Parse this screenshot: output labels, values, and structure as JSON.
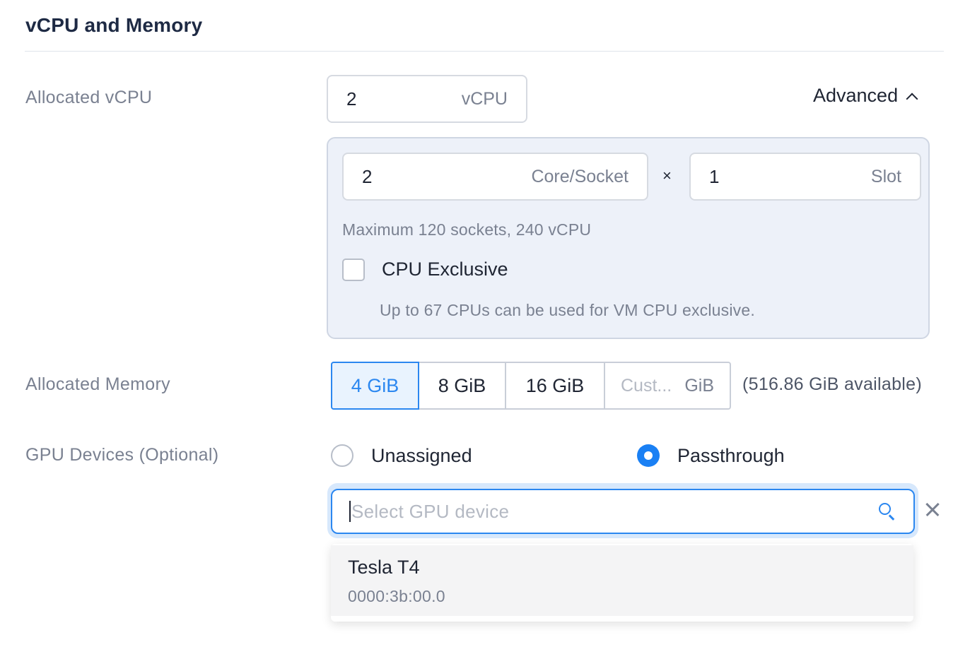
{
  "section": {
    "title": "vCPU and Memory"
  },
  "vcpu": {
    "label": "Allocated vCPU",
    "value": "2",
    "unit": "vCPU",
    "advanced_label": "Advanced",
    "advanced_expanded": true
  },
  "advanced": {
    "cores_value": "2",
    "cores_unit": "Core/Socket",
    "multiply": "×",
    "slots_value": "1",
    "slots_unit": "Slot",
    "max_hint": "Maximum 120 sockets, 240 vCPU",
    "cpu_exclusive_label": "CPU Exclusive",
    "cpu_exclusive_checked": false,
    "cpu_exclusive_hint": "Up to 67 CPUs can be used for VM CPU exclusive."
  },
  "memory": {
    "label": "Allocated Memory",
    "options": [
      "4 GiB",
      "8 GiB",
      "16 GiB"
    ],
    "selected": "4 GiB",
    "custom_placeholder": "Cust...",
    "custom_unit": "GiB",
    "available": "(516.86 GiB available)"
  },
  "gpu": {
    "label": "GPU Devices (Optional)",
    "mode_options": [
      "Unassigned",
      "Passthrough"
    ],
    "selected_mode": "Passthrough",
    "search_placeholder": "Select GPU device",
    "devices": [
      {
        "name": "Tesla T4",
        "address": "0000:3b:00.0"
      }
    ]
  },
  "colors": {
    "accent": "#2b87f0",
    "panel_bg": "#edf1f9",
    "muted_text": "#7a8191"
  }
}
